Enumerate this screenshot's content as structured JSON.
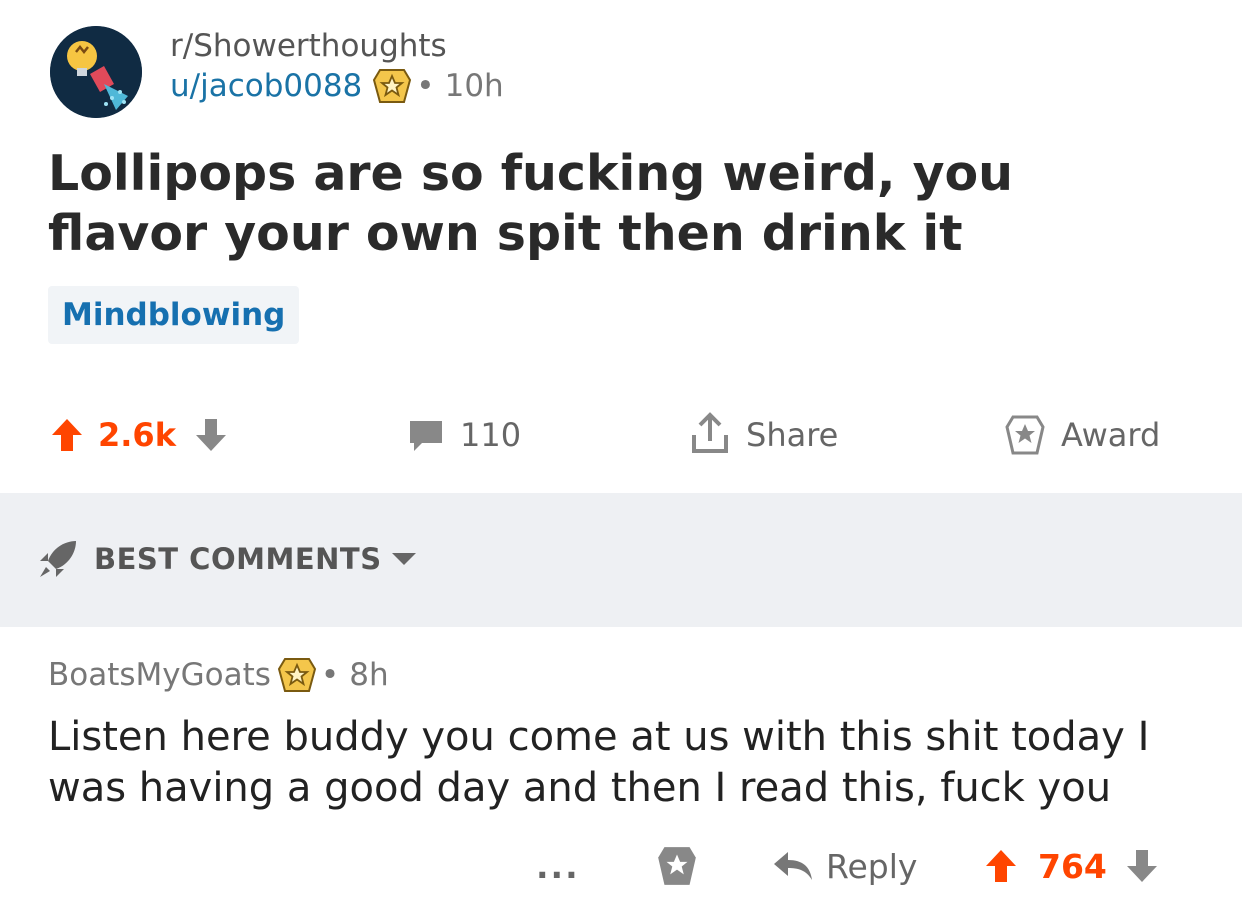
{
  "post": {
    "subreddit": "r/Showerthoughts",
    "user": "u/jacob0088",
    "separator": "•",
    "age": "10h",
    "title": "Lollipops are so fucking weird, you flavor your own spit then drink it",
    "flair": "Mindblowing",
    "score": "2.6k",
    "comment_count": "110",
    "share_label": "Share",
    "award_label": "Award"
  },
  "sort": {
    "label": "BEST COMMENTS"
  },
  "comment": {
    "author": "BoatsMyGoats",
    "separator": "•",
    "age": "8h",
    "body": "Listen here buddy you come at us with this shit today I was having a good day and then I read this, fuck you",
    "more_label": "...",
    "reply_label": "Reply",
    "score": "764"
  },
  "colors": {
    "upvote": "#ff4500",
    "link_blue": "#1a73a6",
    "flair_text": "#1670b0",
    "sort_bar_bg": "#eef0f3",
    "avatar_bg": "#102b43"
  },
  "icons": {
    "avatar": "showerhead-lightbulb-icon",
    "badge": "star-award-badge-icon",
    "upvote": "arrow-up-icon",
    "downvote": "arrow-down-icon",
    "comments": "speech-bubble-icon",
    "share": "share-upload-icon",
    "award": "star-award-icon",
    "sort": "rocket-icon",
    "dropdown": "caret-down-icon",
    "reply": "reply-arrow-icon"
  }
}
